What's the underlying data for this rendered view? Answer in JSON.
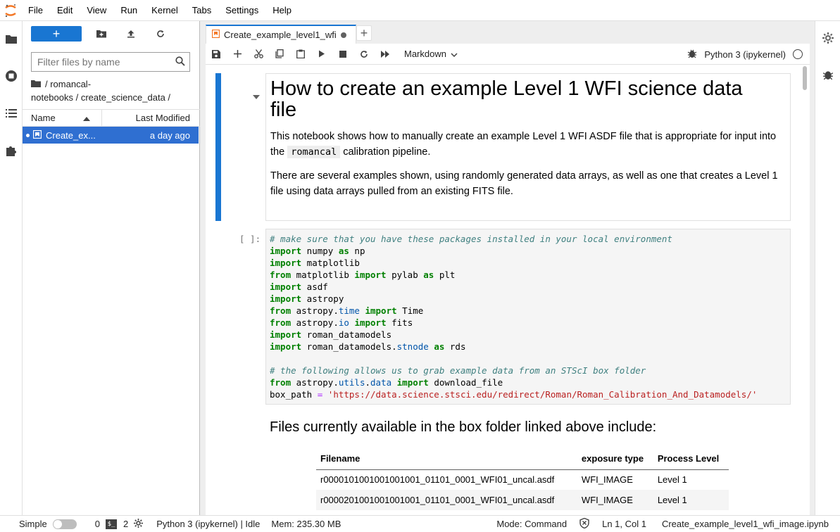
{
  "menubar": {
    "items": [
      "File",
      "Edit",
      "View",
      "Run",
      "Kernel",
      "Tabs",
      "Settings",
      "Help"
    ]
  },
  "left_sidebar": {
    "icons": [
      "folder-icon",
      "running-icon",
      "toc-icon",
      "extension-icon"
    ]
  },
  "file_browser": {
    "new_label": "+",
    "filter_placeholder": "Filter files by name",
    "breadcrumb": "/ romancal-notebooks / create_science_data /",
    "breadcrumb_line1": "/ romancal-",
    "breadcrumb_line2": "notebooks / create_science_data /",
    "col_name": "Name",
    "col_modified": "Last Modified",
    "files": [
      {
        "name": "Create_ex...",
        "modified": "a day ago",
        "selected": true
      }
    ]
  },
  "tabs": {
    "active_label": "Create_example_level1_wfi",
    "add_label": "+"
  },
  "notebook_toolbar": {
    "cell_type": "Markdown",
    "kernel_name": "Python 3 (ipykernel)"
  },
  "notebook": {
    "md_title": "How to create an example Level 1 WFI science data file",
    "md_p1_before": "This notebook shows how to manually create an example Level 1 WFI ASDF file that is appropriate for input into the ",
    "md_p1_code": "romancal",
    "md_p1_after": " calibration pipeline.",
    "md_p2": "There are several examples shown, using randomly generated data arrays, as well as one that creates a Level 1 file using data arrays pulled from an existing FITS file.",
    "code_prompt": "[ ]:",
    "files_heading": "Files currently available in the box folder linked above include:",
    "table": {
      "headers": [
        "Filename",
        "exposure type",
        "Process Level"
      ],
      "rows": [
        [
          "r0000101001001001001_01101_0001_WFI01_uncal.asdf",
          "WFI_IMAGE",
          "Level 1"
        ],
        [
          "r0000201001001001001_01101_0001_WFI01_uncal.asdf",
          "WFI_IMAGE",
          "Level 1"
        ]
      ]
    }
  },
  "statusbar": {
    "mode_label": "Simple",
    "terminals": "0",
    "kernels": "2",
    "kernel_status": "Python 3 (ipykernel) | Idle",
    "memory": "Mem: 235.30 MB",
    "command_mode": "Mode: Command",
    "position": "Ln 1, Col 1",
    "filename": "Create_example_level1_wfi_image.ipynb"
  }
}
